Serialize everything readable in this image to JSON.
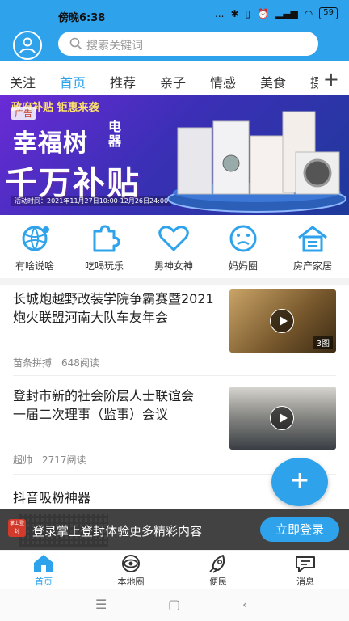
{
  "status_bar": {
    "time": "傍晚6:38",
    "dots": "...",
    "battery": "59",
    "icons": [
      "bluetooth-icon",
      "vibrate-icon",
      "alarm-icon",
      "signal-icon",
      "wifi-icon",
      "battery-icon"
    ]
  },
  "header": {
    "search_placeholder": "搜索关键词"
  },
  "tabs": [
    {
      "label": "关注"
    },
    {
      "label": "首页"
    },
    {
      "label": "推荐"
    },
    {
      "label": "亲子"
    },
    {
      "label": "情感"
    },
    {
      "label": "美食"
    },
    {
      "label": "摄"
    }
  ],
  "active_tab": "首页",
  "banner": {
    "top_strip": "政府补贴 钜惠来袭",
    "ad_tag": "广告",
    "brand": "幸福树",
    "brand_sub": "电器",
    "headline": "千万补贴",
    "date_text": "活动时间：2021年11月27日10:00-12月26日24:00"
  },
  "quick_links": [
    {
      "label": "有啥说啥",
      "icon": "globe-chat-icon"
    },
    {
      "label": "吃喝玩乐",
      "icon": "puzzle-icon"
    },
    {
      "label": "男神女神",
      "icon": "heart-icon"
    },
    {
      "label": "妈妈圈",
      "icon": "smiley-icon"
    },
    {
      "label": "房产家居",
      "icon": "house-icon"
    }
  ],
  "news": [
    {
      "title": "长城炮越野改装学院争霸赛暨2021炮火联盟河南大队车友年会",
      "source": "苗条拼搏",
      "reads": "648阅读",
      "image_count": "3图"
    },
    {
      "title_line1": "登封市新的社会阶层人士联谊会",
      "title_line2": "一届二次理事（监事）会议",
      "source": "超帅",
      "reads": "2717阅读"
    },
    {
      "title": "抖音吸粉神器"
    }
  ],
  "fab": {
    "label": "+"
  },
  "login_bar": {
    "logo_text": "掌上登封",
    "message": "登录掌上登封体验更多精彩内容",
    "button": "立即登录"
  },
  "bottom_nav": [
    {
      "label": "首页",
      "icon": "home-icon"
    },
    {
      "label": "本地圈",
      "icon": "eye-circle-icon"
    },
    {
      "label": "便民",
      "icon": "rocket-icon"
    },
    {
      "label": "消息",
      "icon": "message-icon"
    }
  ],
  "colors": {
    "accent": "#2ea3ec",
    "banner_gradient_start": "#6a2bd6",
    "login_bar_bg": "#282828"
  }
}
